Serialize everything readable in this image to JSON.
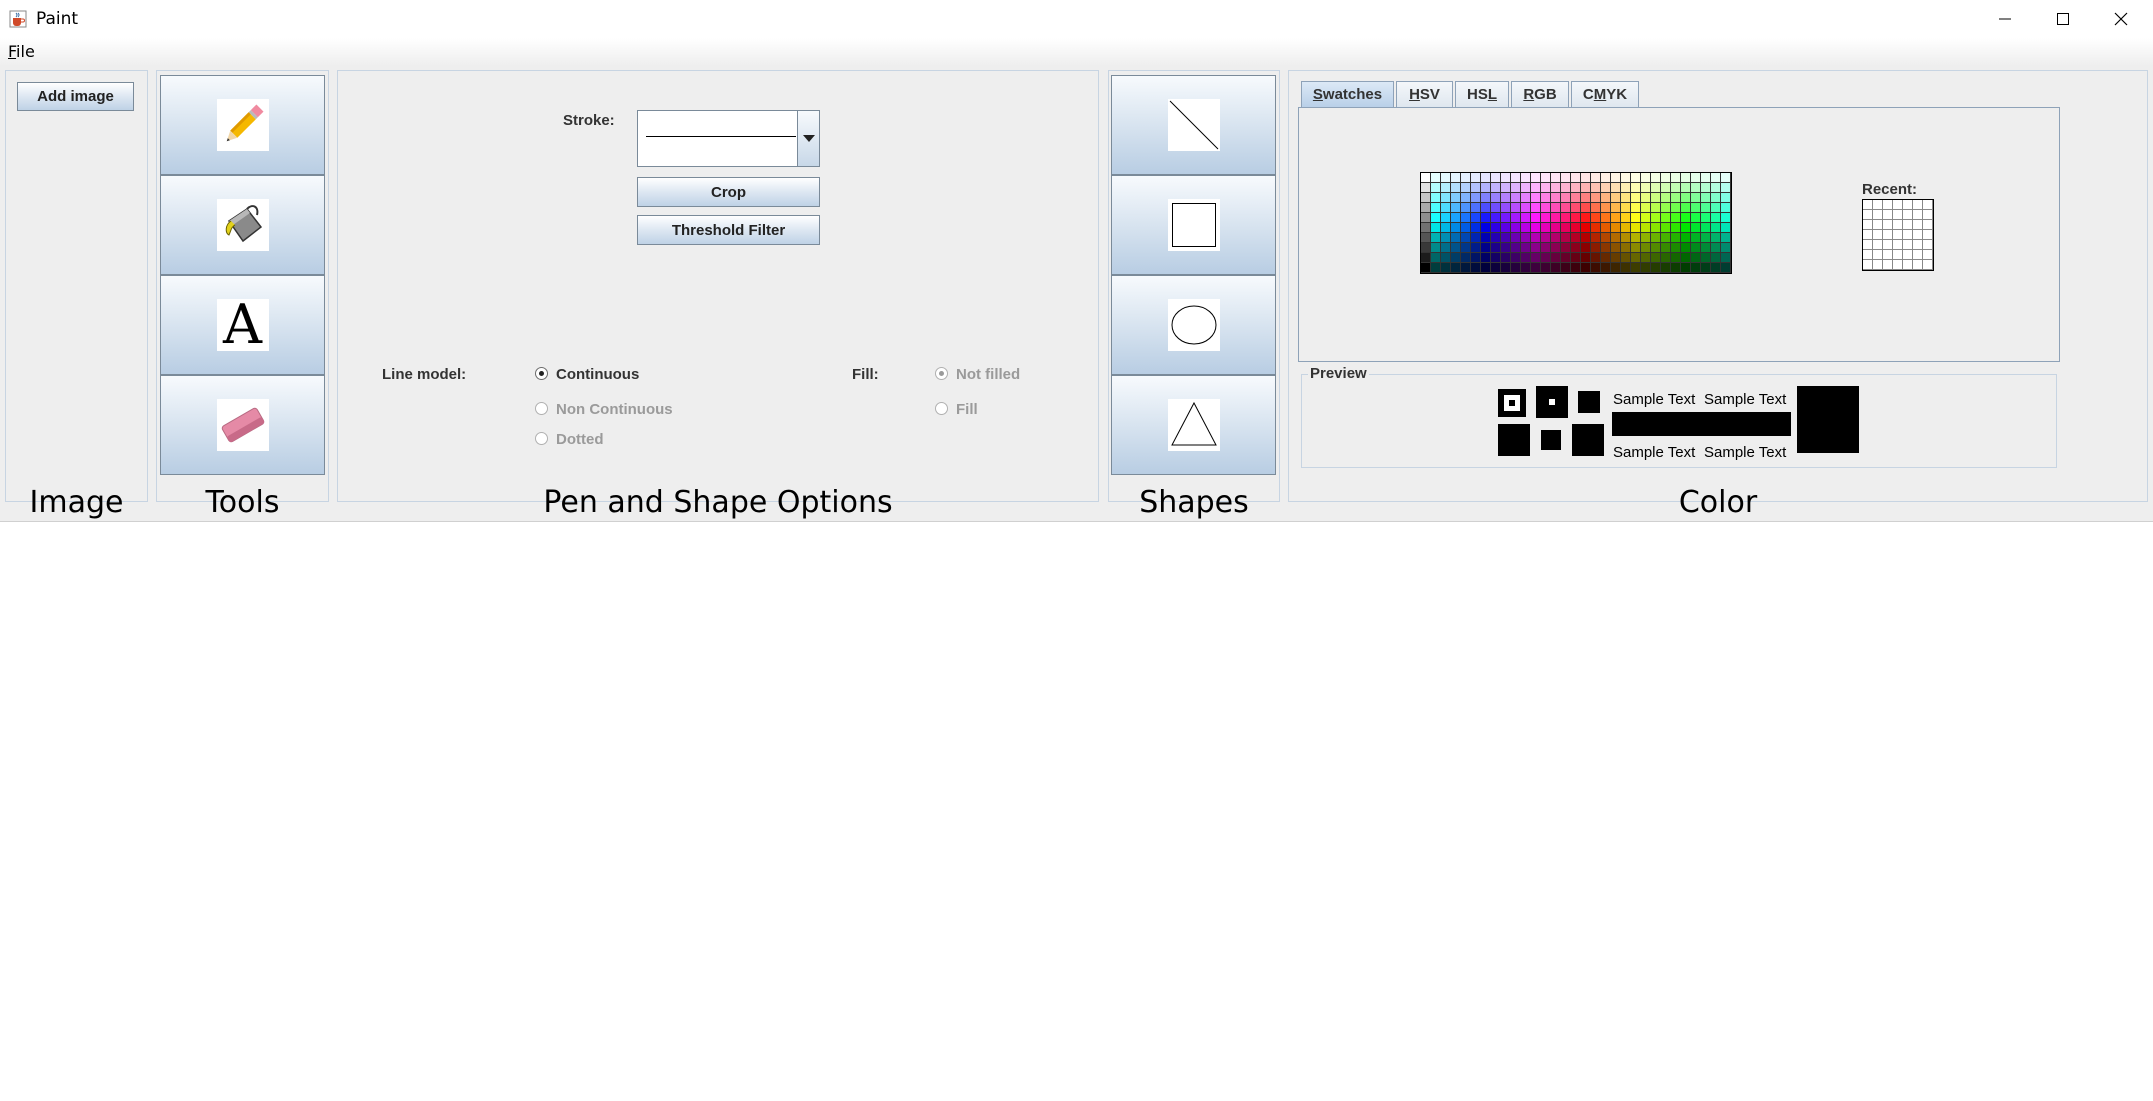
{
  "window": {
    "title": "Paint",
    "app_icon": "java-cup-icon"
  },
  "menu": {
    "file_label": "File"
  },
  "image_panel": {
    "add_image_label": "Add image",
    "title": "Image"
  },
  "tools_panel": {
    "title": "Tools",
    "tools": [
      {
        "name": "pencil-icon"
      },
      {
        "name": "paint-bucket-icon"
      },
      {
        "name": "text-tool-icon",
        "glyph": "A"
      },
      {
        "name": "eraser-icon"
      }
    ]
  },
  "pen_panel": {
    "title": "Pen and Shape Options",
    "stroke_label": "Stroke:",
    "crop_label": "Crop",
    "threshold_label": "Threshold Filter",
    "line_model_label": "Line model:",
    "line_models": [
      "Continuous",
      "Non Continuous",
      "Dotted"
    ],
    "line_model_selected": "Continuous",
    "fill_label": "Fill:",
    "fill_options": [
      "Not filled",
      "Fill"
    ],
    "fill_selected": "Not filled"
  },
  "shapes_panel": {
    "title": "Shapes",
    "shapes": [
      {
        "name": "line-shape-icon"
      },
      {
        "name": "rectangle-shape-icon"
      },
      {
        "name": "ellipse-shape-icon"
      },
      {
        "name": "triangle-shape-icon"
      }
    ]
  },
  "color_panel": {
    "title": "Color",
    "tabs": [
      {
        "label": "Swatches",
        "mnemonic": "S",
        "rest": "watches"
      },
      {
        "label": "HSV",
        "mnemonic": "H",
        "rest": "SV"
      },
      {
        "label": "HSL",
        "pre": "HS",
        "mnemonic": "L"
      },
      {
        "label": "RGB",
        "mnemonic": "R",
        "rest": "GB"
      },
      {
        "label": "CMYK",
        "pre": "C",
        "mnemonic": "M",
        "rest": "YK"
      }
    ],
    "active_tab": "Swatches",
    "recent_label": "Recent:",
    "preview_label": "Preview",
    "sample_text": "Sample Text",
    "selected_color": "#000000"
  }
}
